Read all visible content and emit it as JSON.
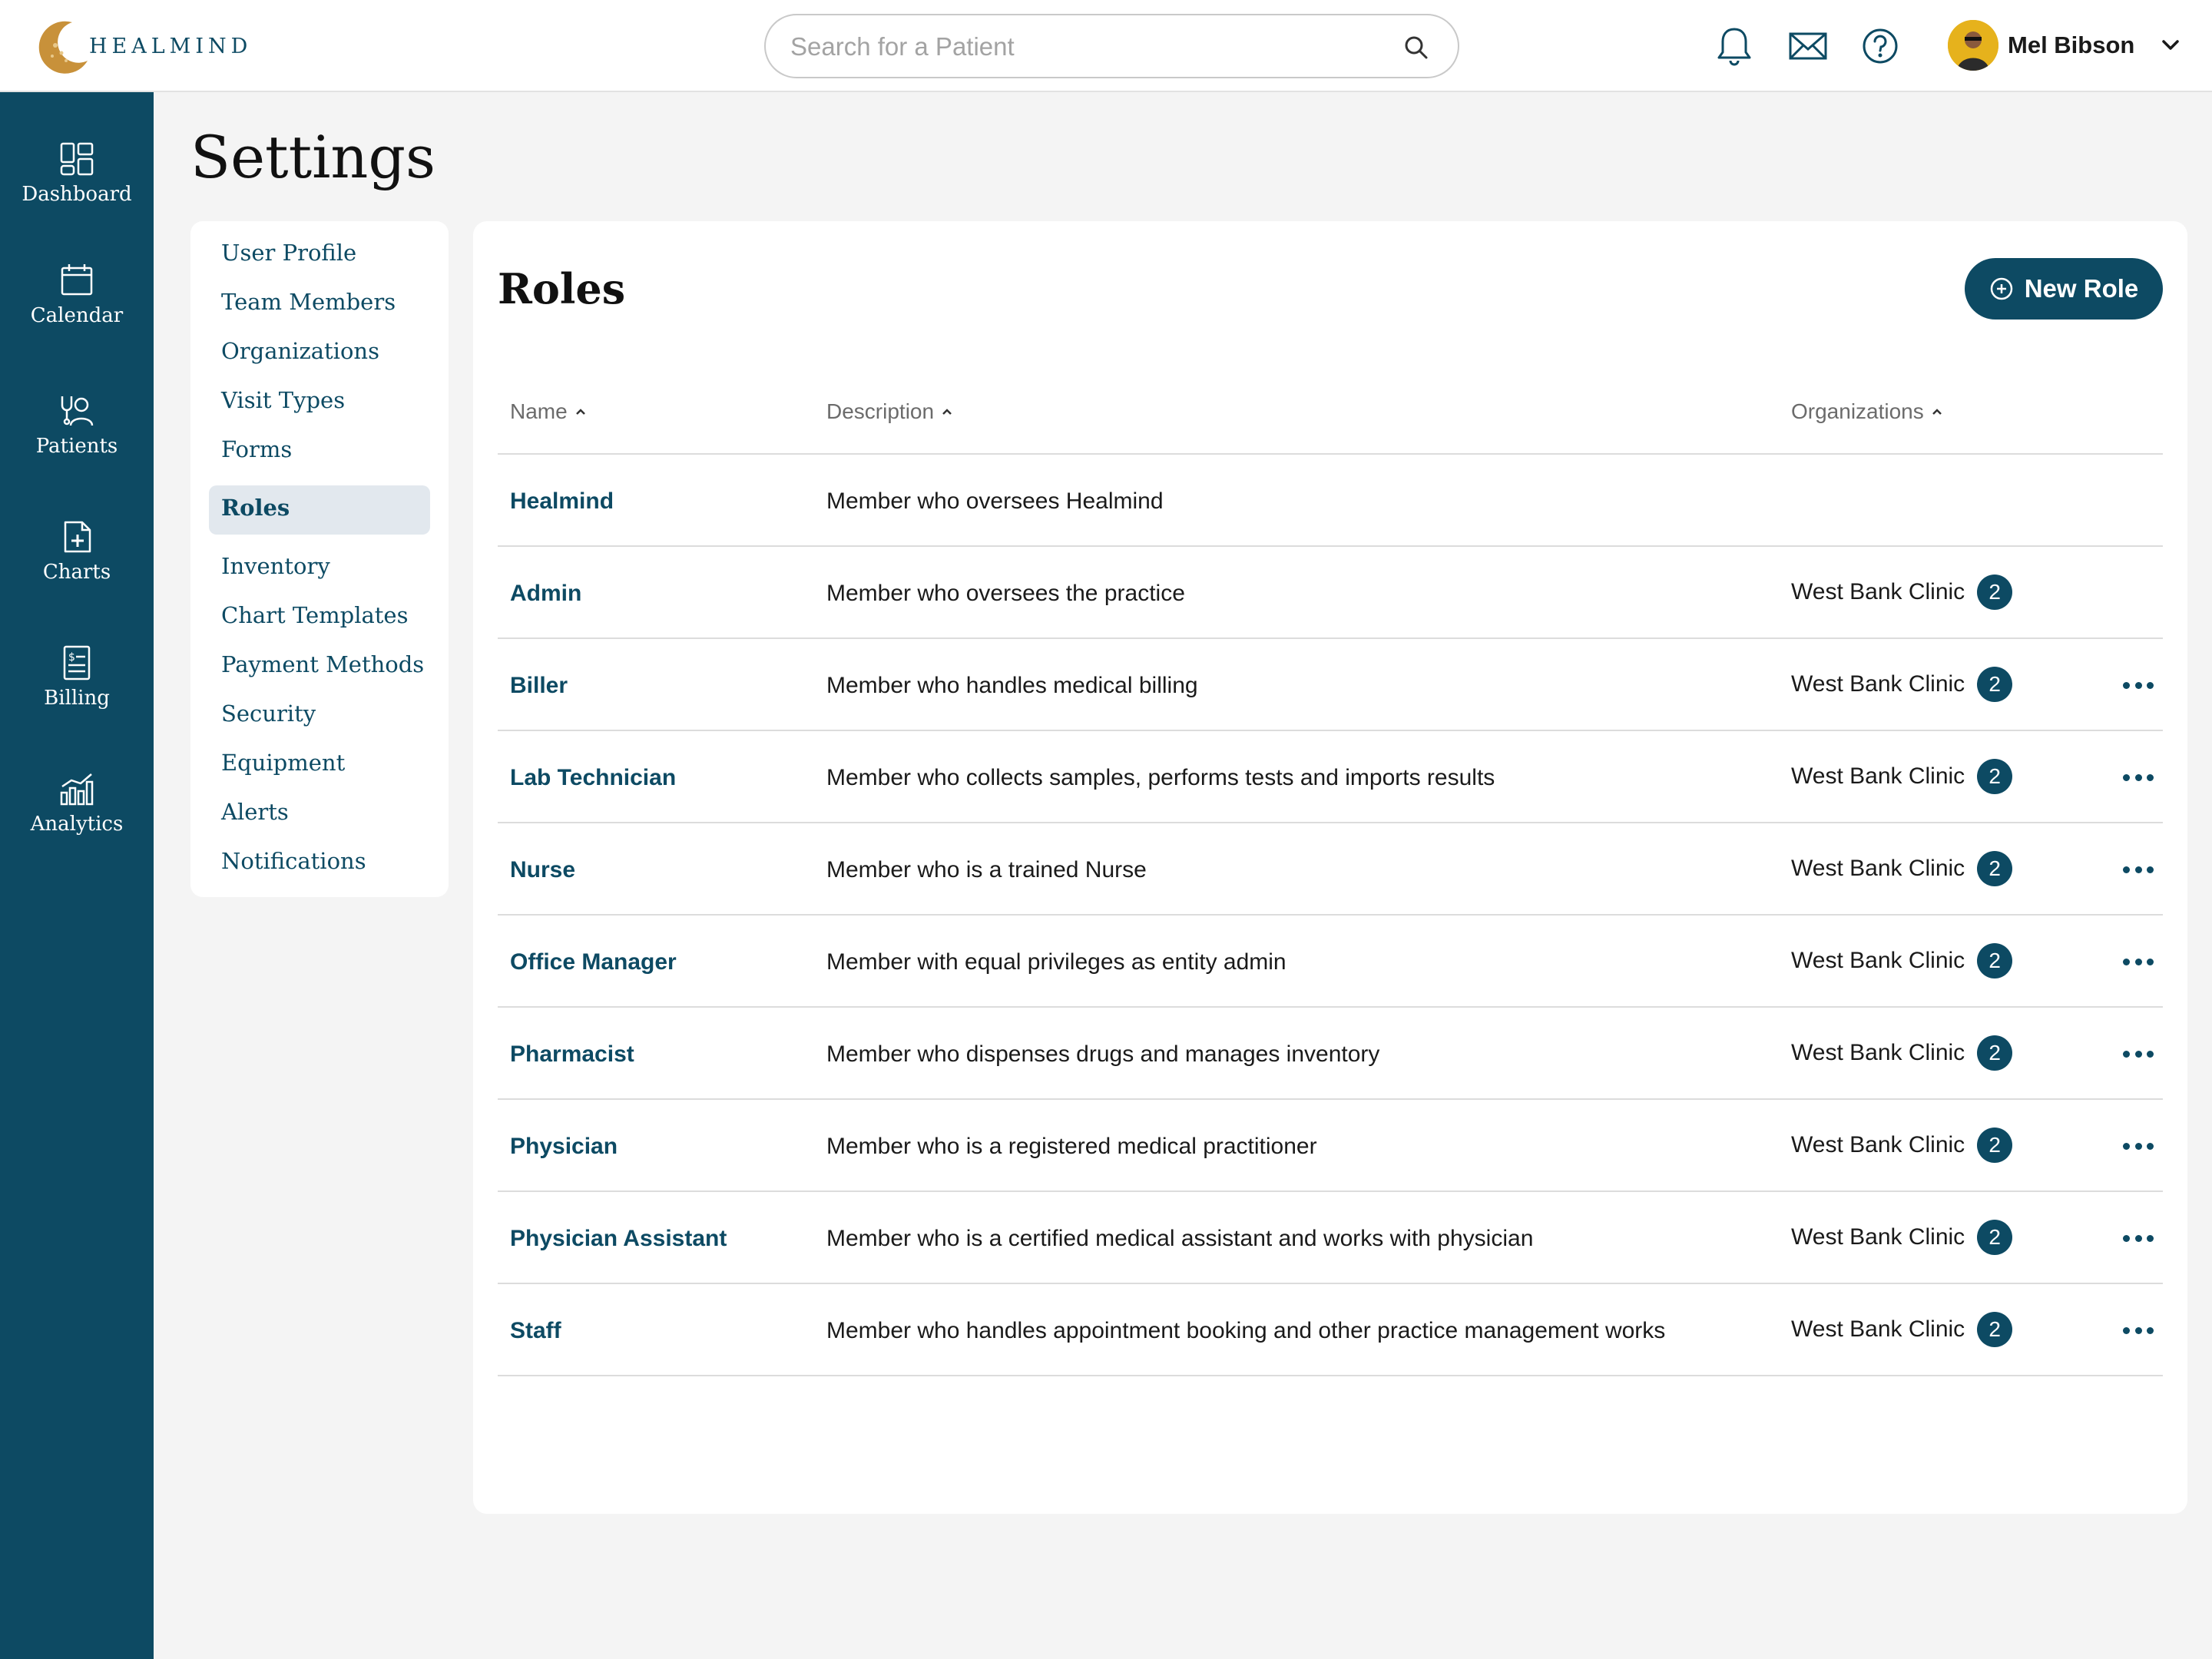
{
  "app": {
    "logo_text": "HEALMIND"
  },
  "header": {
    "search_placeholder": "Search for a Patient",
    "user_name": "Mel Bibson"
  },
  "sidebar": {
    "items": [
      {
        "label": "Dashboard",
        "icon": "dashboard-icon"
      },
      {
        "label": "Calendar",
        "icon": "calendar-icon"
      },
      {
        "label": "Patients",
        "icon": "patients-icon"
      },
      {
        "label": "Charts",
        "icon": "charts-icon"
      },
      {
        "label": "Billing",
        "icon": "billing-icon"
      },
      {
        "label": "Analytics",
        "icon": "analytics-icon"
      }
    ]
  },
  "page": {
    "title": "Settings"
  },
  "settings_menu": {
    "active": "Roles",
    "items": [
      "User Profile",
      "Team Members",
      "Organizations",
      "Visit Types",
      "Forms",
      "Roles",
      "Inventory",
      "Chart Templates",
      "Payment Methods",
      "Security",
      "Equipment",
      "Alerts",
      "Notifications"
    ]
  },
  "roles": {
    "title": "Roles",
    "new_button": "New Role",
    "columns": {
      "name": "Name",
      "description": "Description",
      "organizations": "Organizations"
    },
    "rows": [
      {
        "name": "Healmind",
        "description": "Member who oversees Healmind",
        "org": "",
        "count": ""
      },
      {
        "name": "Admin",
        "description": "Member who oversees the practice",
        "org": "West Bank Clinic",
        "count": "2"
      },
      {
        "name": "Biller",
        "description": "Member who handles medical billing",
        "org": "West Bank Clinic",
        "count": "2"
      },
      {
        "name": "Lab Technician",
        "description": "Member who collects samples, performs tests and imports results",
        "org": "West Bank Clinic",
        "count": "2"
      },
      {
        "name": "Nurse",
        "description": "Member who is a trained Nurse",
        "org": "West Bank Clinic",
        "count": "2"
      },
      {
        "name": "Office Manager",
        "description": "Member with equal privileges as entity admin",
        "org": "West Bank Clinic",
        "count": "2"
      },
      {
        "name": "Pharmacist",
        "description": "Member who dispenses drugs and manages inventory",
        "org": "West Bank Clinic",
        "count": "2"
      },
      {
        "name": "Physician",
        "description": "Member who is a registered medical practitioner",
        "org": "West Bank Clinic",
        "count": "2"
      },
      {
        "name": "Physician Assistant",
        "description": "Member who is a certified medical assistant and works with physician",
        "org": "West Bank Clinic",
        "count": "2"
      },
      {
        "name": "Staff",
        "description": "Member who handles appointment booking and other practice management works",
        "org": "West Bank Clinic",
        "count": "2"
      }
    ]
  },
  "colors": {
    "primary": "#0d4a63",
    "accent_gold": "#c8913a",
    "background": "#f4f4f4"
  }
}
